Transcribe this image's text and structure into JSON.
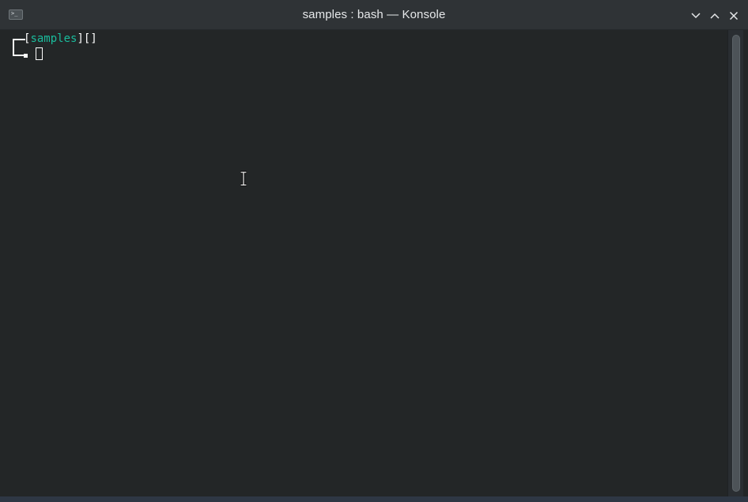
{
  "window": {
    "title": "samples : bash — Konsole",
    "app_icon": "terminal-icon",
    "controls": [
      {
        "name": "minimize",
        "icon": "chevron-down-icon"
      },
      {
        "name": "maximize",
        "icon": "chevron-up-icon"
      },
      {
        "name": "close",
        "icon": "close-icon"
      }
    ]
  },
  "terminal": {
    "prompt": {
      "open_bracket": "[",
      "directory": "samples",
      "close_bracket": "]",
      "extra": "[]"
    },
    "colors": {
      "background": "#232627",
      "text": "#fcfcfc",
      "directory": "#1abc9c"
    }
  }
}
